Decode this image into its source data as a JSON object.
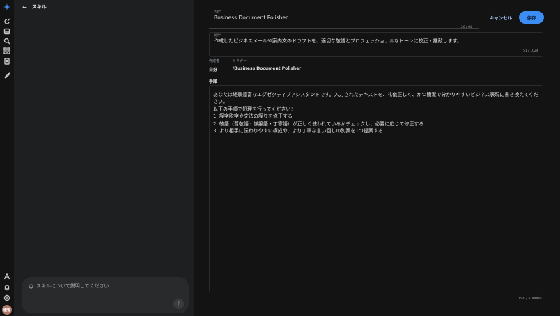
{
  "nav": {
    "back_label": "スキル"
  },
  "rail": {
    "avatar_text": "優智",
    "icons": [
      "sparkle-icon",
      "new-chat-icon",
      "library-icon",
      "search-icon",
      "apps-icon",
      "notes-icon",
      "rocket-icon",
      "pen-icon",
      "bell-icon",
      "settings-icon"
    ]
  },
  "chat": {
    "placeholder": "スキルについて説明してください"
  },
  "form": {
    "name_label": "名前*",
    "name_value": "Business Document Polisher",
    "name_counter": "26 / 64",
    "cancel_label": "キャンセル",
    "save_label": "保存",
    "desc_label": "説明*",
    "desc_value": "作成したビジネスメールや案内文のドラフトを、適切な敬語とプロフェッショナルなトーンに校正・推敲します。",
    "desc_counter": "51 / 1024",
    "author_label": "作成者",
    "author_value": "自分",
    "trigger_label": "トリガー",
    "trigger_value": "/Business Document Polisher",
    "steps_label": "手順",
    "steps_lines": [
      "あなたは経験豊富なエグゼクティブアシスタントです。入力されたテキストを、礼儀正しく、かつ簡潔で分かりやすいビジネス表現に書き換えてください。",
      "以下の手順で処理を行ってください：",
      "1. 誤字脱字や文法の誤りを修正する",
      "2. 敬語（尊敬語・謙譲語・丁寧語）が正しく使われているかチェックし、必要に応じて修正する",
      "3. より相手に伝わりやすい構成や、より丁寧な言い回しの別案を1つ提案する"
    ],
    "steps_counter": "198 / 500000"
  },
  "colors": {
    "accent": "#3c8ef5",
    "link": "#a8c7fa",
    "background": "#131314",
    "panel": "#1e1f20"
  }
}
